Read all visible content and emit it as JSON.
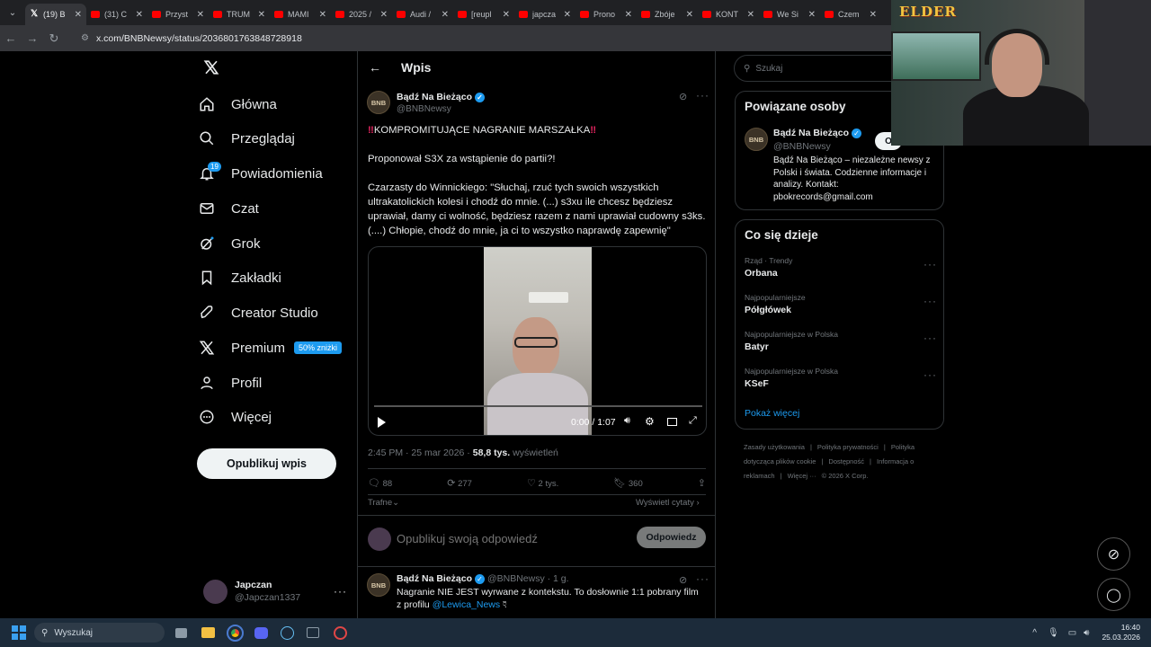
{
  "browser": {
    "tabs": [
      {
        "label": "(19) B",
        "type": "x",
        "active": true
      },
      {
        "label": "(31) C",
        "type": "yt"
      },
      {
        "label": "Przyst",
        "type": "yt"
      },
      {
        "label": "TRUM",
        "type": "yt"
      },
      {
        "label": "MAMI",
        "type": "yt"
      },
      {
        "label": "2025 /",
        "type": "yt"
      },
      {
        "label": "Audi /",
        "type": "yt"
      },
      {
        "label": "[reupl",
        "type": "yt"
      },
      {
        "label": "japcza",
        "type": "yt"
      },
      {
        "label": "Prono",
        "type": "yt"
      },
      {
        "label": "Zbóje",
        "type": "yt"
      },
      {
        "label": "KONT",
        "type": "yt"
      },
      {
        "label": "We Si",
        "type": "yt"
      },
      {
        "label": "Czem",
        "type": "yt"
      }
    ],
    "url": "x.com/BNBNewsy/status/2036801763848728918"
  },
  "nav": {
    "items": [
      {
        "label": "Główna",
        "icon": "home-icon"
      },
      {
        "label": "Przeglądaj",
        "icon": "search-icon"
      },
      {
        "label": "Powiadomienia",
        "icon": "bell-icon",
        "badge": "19"
      },
      {
        "label": "Czat",
        "icon": "mail-icon"
      },
      {
        "label": "Grok",
        "icon": "grok-icon"
      },
      {
        "label": "Zakładki",
        "icon": "bookmark-icon"
      },
      {
        "label": "Creator Studio",
        "icon": "rocket-icon"
      },
      {
        "label": "Premium",
        "icon": "x-logo-icon",
        "promo": "50% zniżki"
      },
      {
        "label": "Profil",
        "icon": "person-icon"
      },
      {
        "label": "Więcej",
        "icon": "more-circle-icon"
      }
    ],
    "post_button": "Opublikuj wpis",
    "user": {
      "name": "Japczan",
      "handle": "@Japczan1337"
    }
  },
  "post": {
    "header_title": "Wpis",
    "author": "Bądź Na Bieżąco",
    "handle": "@BNBNewsy",
    "avatar_text": "BNB",
    "headline": "KOMPROMITUJĄCE NAGRANIE MARSZAŁKA",
    "line2": "Proponował S3X za wstąpienie do partii?!",
    "body": "Czarzasty do Winnickiego: \"Słuchaj, rzuć tych swoich wszystkich ultrakatolickich kolesi i chodź do mnie. (...) s3xu ile chcesz będziesz uprawiał, damy ci wolność, będziesz razem z nami uprawiał cudowny s3ks. (....) Chłopie, chodź do mnie, ja ci to wszystko naprawdę zapewnię\"",
    "video": {
      "time": "0:00 / 1:07",
      "progress": 0
    },
    "timestamp": "2:45 PM · 25 mar 2026 ·",
    "views_count": "58,8 tys.",
    "views_label": "wyświetleń",
    "replies": "88",
    "reposts": "277",
    "likes": "2 tys.",
    "bookmarks": "360",
    "sort_label": "Trafne",
    "quotes_label": "Wyświetl cytaty",
    "reply_placeholder": "Opublikuj swoją odpowiedź",
    "reply_button": "Odpowiedz"
  },
  "reply": {
    "author": "Bądź Na Bieżąco",
    "meta": "@BNBNewsy · 1 g.",
    "text": "Nagranie NIE JEST wyrwane z kontekstu. To dosłownie 1:1 pobrany film z profilu",
    "mention": "@Lewica_News"
  },
  "sidebar": {
    "search_placeholder": "Szukaj",
    "related_title": "Powiązane osoby",
    "related_name": "Bądź Na Bieżąco",
    "related_handle": "@BNBNewsy",
    "related_follow": "O",
    "related_bio": "Bądź Na Bieżąco – niezależne newsy z Polski i świata. Codzienne informacje i analizy. Kontakt: pbokrecords@gmail.com",
    "trends_title": "Co się dzieje",
    "trends": [
      {
        "context": "Rząd · Trendy",
        "name": "Orbana"
      },
      {
        "context": "Najpopularniejsze",
        "name": "Półgłówek"
      },
      {
        "context": "Najpopularniejsze w Polska",
        "name": "Batyr"
      },
      {
        "context": "Najpopularniejsze w Polska",
        "name": "KSeF"
      }
    ],
    "show_more": "Pokaż więcej",
    "footer": [
      "Zasady użytkowania",
      "|",
      "Polityka prywatności",
      "|",
      "Polityka dotycząca plików cookie",
      "|",
      "Dostępność",
      "|",
      "Informacja o reklamach",
      "|",
      "Więcej ···",
      "© 2026 X Corp."
    ]
  },
  "overlay": {
    "logo_text": "ELDER"
  },
  "taskbar": {
    "search": "Wyszukaj",
    "time": "16:40",
    "date": "25.03.2026"
  },
  "colors": {
    "accent": "#1d9bf0",
    "bg": "#000000",
    "border": "#2f3336",
    "muted": "#71767b"
  }
}
